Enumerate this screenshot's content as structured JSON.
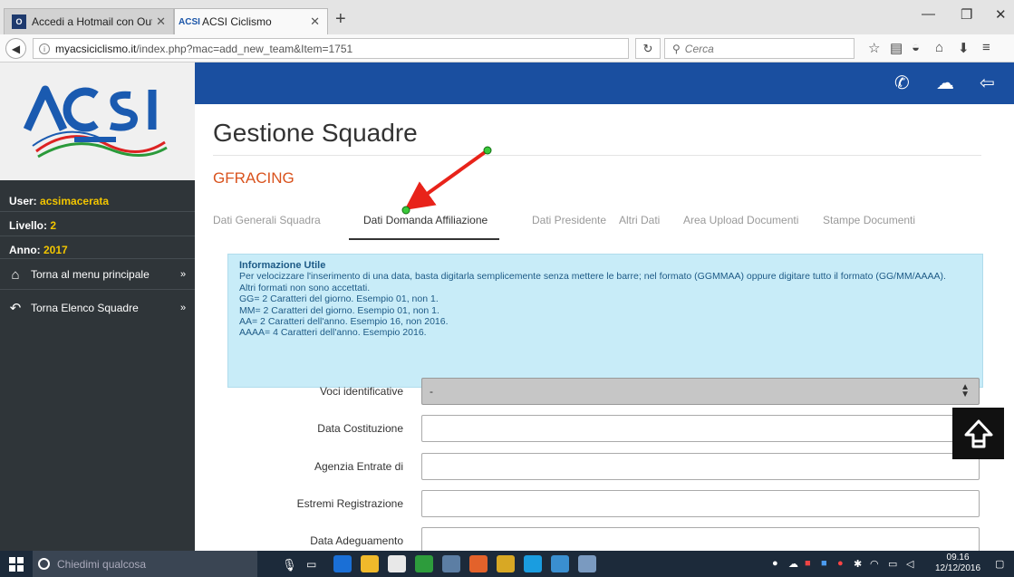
{
  "browser": {
    "tabs": [
      {
        "title": "Accedi a Hotmail con Out...",
        "favicon": "outlook-favicon"
      },
      {
        "title": "ACSI Ciclismo",
        "favicon": "acsi-favicon"
      }
    ],
    "url": {
      "host": "myacsiciclismo.it",
      "path": "/index.php?mac=add_new_team&Item=1751"
    },
    "search_placeholder": "Cerca"
  },
  "sidebar": {
    "user_label": "User:",
    "user_value": "acsimacerata",
    "level_label": "Livello:",
    "level_value": "2",
    "year_label": "Anno:",
    "year_value": "2017",
    "menu": [
      {
        "label": "Torna al menu principale",
        "icon": "home-icon"
      },
      {
        "label": "Torna Elenco Squadre",
        "icon": "back-arrow-icon"
      }
    ]
  },
  "main": {
    "title": "Gestione Squadre",
    "team": "GFRACING",
    "tabs": [
      {
        "label": "Dati Generali Squadra",
        "active": false
      },
      {
        "label": "Dati Domanda Affiliazione",
        "active": true
      },
      {
        "label": "Dati Presidente",
        "active": false
      },
      {
        "label": "Altri Dati",
        "active": false
      },
      {
        "label": "Area Upload Documenti",
        "active": false
      },
      {
        "label": "Stampe Documenti",
        "active": false
      }
    ],
    "info": {
      "heading": "Informazione Utile",
      "lines": [
        "Per velocizzare l'inserimento di una data, basta digitarla semplicemente senza mettere le barre; nel formato (GGMMAA) oppure digitare tutto il formato (GG/MM/AAAA).",
        "Altri formati non sono accettati.",
        "GG= 2 Caratteri del giorno. Esempio 01, non 1.",
        "MM= 2 Caratteri del giorno. Esempio 01, non 1.",
        "AA= 2 Caratteri dell'anno. Esempio 16, non 2016.",
        "AAAA= 4 Caratteri dell'anno. Esempio 2016."
      ]
    },
    "form": [
      {
        "label": "Voci identificative",
        "type": "select",
        "value": "-"
      },
      {
        "label": "Data Costituzione",
        "type": "text",
        "value": ""
      },
      {
        "label": "Agenzia Entrate di",
        "type": "text",
        "value": ""
      },
      {
        "label": "Estremi Registrazione",
        "type": "text",
        "value": ""
      },
      {
        "label": "Data Adeguamento",
        "type": "text",
        "value": ""
      }
    ]
  },
  "taskbar": {
    "search_placeholder": "Chiedimi qualcosa",
    "time": "09.16",
    "date": "12/12/2016"
  },
  "colors": {
    "topbar": "#1a4fa0",
    "sidebar": "#2f3539",
    "accent_yellow": "#f2c500",
    "team_orange": "#d9531e",
    "info_bg": "#c8ecf8",
    "annotation_red": "#e8231a"
  }
}
